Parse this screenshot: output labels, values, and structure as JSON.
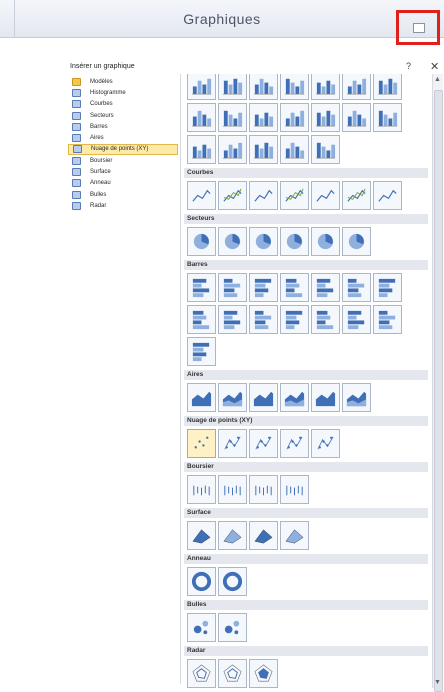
{
  "ribbon": {
    "title": "Graphiques",
    "launcher_icon": "dialog-launcher-icon"
  },
  "dialog": {
    "title": "Insérer un graphique",
    "help": "?",
    "close": "✕",
    "categories": [
      {
        "label": "Modèles",
        "icon": "folder-icon"
      },
      {
        "label": "Histogramme",
        "icon": "column-chart-icon"
      },
      {
        "label": "Courbes",
        "icon": "line-chart-icon"
      },
      {
        "label": "Secteurs",
        "icon": "pie-chart-icon"
      },
      {
        "label": "Barres",
        "icon": "bar-chart-icon"
      },
      {
        "label": "Aires",
        "icon": "area-chart-icon"
      },
      {
        "label": "Nuage de points (XY)",
        "icon": "scatter-chart-icon",
        "selected": true
      },
      {
        "label": "Boursier",
        "icon": "stock-chart-icon"
      },
      {
        "label": "Surface",
        "icon": "surface-chart-icon"
      },
      {
        "label": "Anneau",
        "icon": "doughnut-chart-icon"
      },
      {
        "label": "Bulles",
        "icon": "bubble-chart-icon"
      },
      {
        "label": "Radar",
        "icon": "radar-chart-icon"
      }
    ]
  },
  "gallery": {
    "sections": [
      {
        "key": "histogramme",
        "name": "",
        "rows": [
          7,
          7,
          5
        ],
        "kind": "column"
      },
      {
        "key": "courbes",
        "name": "Courbes",
        "rows": [
          7
        ],
        "kind": "line"
      },
      {
        "key": "secteurs",
        "name": "Secteurs",
        "rows": [
          6
        ],
        "kind": "pie"
      },
      {
        "key": "barres",
        "name": "Barres",
        "rows": [
          7,
          7,
          1
        ],
        "kind": "bar"
      },
      {
        "key": "aires",
        "name": "Aires",
        "rows": [
          6
        ],
        "kind": "area"
      },
      {
        "key": "nuage",
        "name": "Nuage de points (XY)",
        "rows": [
          5
        ],
        "kind": "scatter",
        "selected": 0
      },
      {
        "key": "boursier",
        "name": "Boursier",
        "rows": [
          4
        ],
        "kind": "stock"
      },
      {
        "key": "surface",
        "name": "Surface",
        "rows": [
          4
        ],
        "kind": "surface"
      },
      {
        "key": "anneau",
        "name": "Anneau",
        "rows": [
          2
        ],
        "kind": "doughnut"
      },
      {
        "key": "bulles",
        "name": "Bulles",
        "rows": [
          2
        ],
        "kind": "bubble"
      },
      {
        "key": "radar",
        "name": "Radar",
        "rows": [
          3
        ],
        "kind": "radar"
      }
    ]
  },
  "colors": {
    "accent_blue": "#3f6fb6",
    "light_blue": "#8fb0df",
    "selection": "#fde9a8",
    "highlight_red": "#e0201b"
  }
}
